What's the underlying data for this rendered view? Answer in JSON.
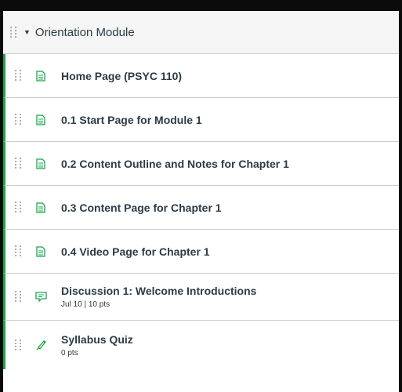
{
  "module": {
    "title": "Orientation Module",
    "items": [
      {
        "title": "Home Page (PSYC 110)",
        "type": "page",
        "icon": "page-icon"
      },
      {
        "title": "0.1 Start Page for Module 1",
        "type": "page",
        "icon": "page-icon"
      },
      {
        "title": "0.2 Content Outline and Notes for Chapter 1",
        "type": "page",
        "icon": "page-icon"
      },
      {
        "title": "0.3 Content Page for Chapter 1",
        "type": "page",
        "icon": "page-icon"
      },
      {
        "title": "0.4 Video Page for Chapter 1",
        "type": "page",
        "icon": "page-icon"
      },
      {
        "title": "Discussion 1: Welcome Introductions",
        "type": "discussion",
        "icon": "discussion-icon",
        "date": "Jul 10",
        "separator": "|",
        "points": "10 pts"
      },
      {
        "title": "Syllabus Quiz",
        "type": "quiz",
        "icon": "quiz-icon",
        "points": "0 pts"
      }
    ]
  },
  "colors": {
    "published_border": "#19a84a",
    "icon_green": "#19a84a",
    "text": "#2d3b45",
    "header_bg": "#f5f5f5"
  }
}
